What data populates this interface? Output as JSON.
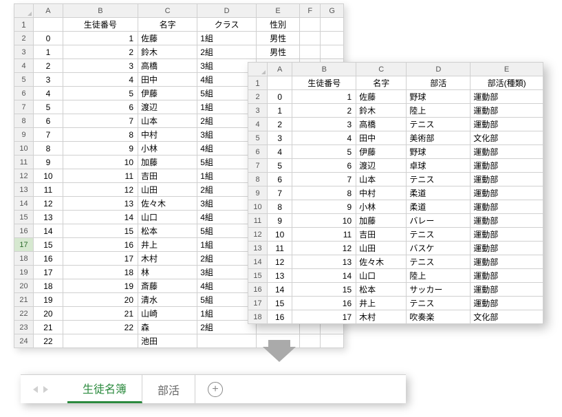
{
  "sheet1": {
    "col_letters": [
      "A",
      "B",
      "C",
      "D",
      "E",
      "F",
      "G"
    ],
    "headers": [
      "",
      "生徒番号",
      "名字",
      "クラス",
      "性別"
    ],
    "active_row": 17,
    "rows": [
      {
        "n": 2,
        "a": "0",
        "b": "1",
        "c": "佐藤",
        "d": "1組",
        "e": "男性"
      },
      {
        "n": 3,
        "a": "1",
        "b": "2",
        "c": "鈴木",
        "d": "2組",
        "e": "男性"
      },
      {
        "n": 4,
        "a": "2",
        "b": "3",
        "c": "高橋",
        "d": "3組",
        "e": ""
      },
      {
        "n": 5,
        "a": "3",
        "b": "4",
        "c": "田中",
        "d": "4組",
        "e": ""
      },
      {
        "n": 6,
        "a": "4",
        "b": "5",
        "c": "伊藤",
        "d": "5組",
        "e": ""
      },
      {
        "n": 7,
        "a": "5",
        "b": "6",
        "c": "渡辺",
        "d": "1組",
        "e": ""
      },
      {
        "n": 8,
        "a": "6",
        "b": "7",
        "c": "山本",
        "d": "2組",
        "e": ""
      },
      {
        "n": 9,
        "a": "7",
        "b": "8",
        "c": "中村",
        "d": "3組",
        "e": ""
      },
      {
        "n": 10,
        "a": "8",
        "b": "9",
        "c": "小林",
        "d": "4組",
        "e": ""
      },
      {
        "n": 11,
        "a": "9",
        "b": "10",
        "c": "加藤",
        "d": "5組",
        "e": ""
      },
      {
        "n": 12,
        "a": "10",
        "b": "11",
        "c": "吉田",
        "d": "1組",
        "e": ""
      },
      {
        "n": 13,
        "a": "11",
        "b": "12",
        "c": "山田",
        "d": "2組",
        "e": ""
      },
      {
        "n": 14,
        "a": "12",
        "b": "13",
        "c": "佐々木",
        "d": "3組",
        "e": ""
      },
      {
        "n": 15,
        "a": "13",
        "b": "14",
        "c": "山口",
        "d": "4組",
        "e": ""
      },
      {
        "n": 16,
        "a": "14",
        "b": "15",
        "c": "松本",
        "d": "5組",
        "e": ""
      },
      {
        "n": 17,
        "a": "15",
        "b": "16",
        "c": "井上",
        "d": "1組",
        "e": ""
      },
      {
        "n": 18,
        "a": "16",
        "b": "17",
        "c": "木村",
        "d": "2組",
        "e": ""
      },
      {
        "n": 19,
        "a": "17",
        "b": "18",
        "c": "林",
        "d": "3組",
        "e": ""
      },
      {
        "n": 20,
        "a": "18",
        "b": "19",
        "c": "斎藤",
        "d": "4組",
        "e": ""
      },
      {
        "n": 21,
        "a": "19",
        "b": "20",
        "c": "清水",
        "d": "5組",
        "e": ""
      },
      {
        "n": 22,
        "a": "20",
        "b": "21",
        "c": "山崎",
        "d": "1組",
        "e": ""
      },
      {
        "n": 23,
        "a": "21",
        "b": "22",
        "c": "森",
        "d": "2組",
        "e": ""
      },
      {
        "n": 24,
        "a": "22",
        "b": "",
        "c": "池田",
        "d": "",
        "e": ""
      }
    ]
  },
  "sheet2": {
    "col_letters": [
      "A",
      "B",
      "C",
      "D",
      "E"
    ],
    "headers": [
      "",
      "生徒番号",
      "名字",
      "部活",
      "部活(種類)"
    ],
    "rows": [
      {
        "n": 2,
        "a": "0",
        "b": "1",
        "c": "佐藤",
        "d": "野球",
        "e": "運動部"
      },
      {
        "n": 3,
        "a": "1",
        "b": "2",
        "c": "鈴木",
        "d": "陸上",
        "e": "運動部"
      },
      {
        "n": 4,
        "a": "2",
        "b": "3",
        "c": "高橋",
        "d": "テニス",
        "e": "運動部"
      },
      {
        "n": 5,
        "a": "3",
        "b": "4",
        "c": "田中",
        "d": "美術部",
        "e": "文化部"
      },
      {
        "n": 6,
        "a": "4",
        "b": "5",
        "c": "伊藤",
        "d": "野球",
        "e": "運動部"
      },
      {
        "n": 7,
        "a": "5",
        "b": "6",
        "c": "渡辺",
        "d": "卓球",
        "e": "運動部"
      },
      {
        "n": 8,
        "a": "6",
        "b": "7",
        "c": "山本",
        "d": "テニス",
        "e": "運動部"
      },
      {
        "n": 9,
        "a": "7",
        "b": "8",
        "c": "中村",
        "d": "柔道",
        "e": "運動部"
      },
      {
        "n": 10,
        "a": "8",
        "b": "9",
        "c": "小林",
        "d": "柔道",
        "e": "運動部"
      },
      {
        "n": 11,
        "a": "9",
        "b": "10",
        "c": "加藤",
        "d": "バレー",
        "e": "運動部"
      },
      {
        "n": 12,
        "a": "10",
        "b": "11",
        "c": "吉田",
        "d": "テニス",
        "e": "運動部"
      },
      {
        "n": 13,
        "a": "11",
        "b": "12",
        "c": "山田",
        "d": "バスケ",
        "e": "運動部"
      },
      {
        "n": 14,
        "a": "12",
        "b": "13",
        "c": "佐々木",
        "d": "テニス",
        "e": "運動部"
      },
      {
        "n": 15,
        "a": "13",
        "b": "14",
        "c": "山口",
        "d": "陸上",
        "e": "運動部"
      },
      {
        "n": 16,
        "a": "14",
        "b": "15",
        "c": "松本",
        "d": "サッカー",
        "e": "運動部"
      },
      {
        "n": 17,
        "a": "15",
        "b": "16",
        "c": "井上",
        "d": "テニス",
        "e": "運動部"
      },
      {
        "n": 18,
        "a": "16",
        "b": "17",
        "c": "木村",
        "d": "吹奏楽",
        "e": "文化部"
      }
    ]
  },
  "tabs": {
    "active": "生徒名簿",
    "other": "部活",
    "plus": "+"
  }
}
